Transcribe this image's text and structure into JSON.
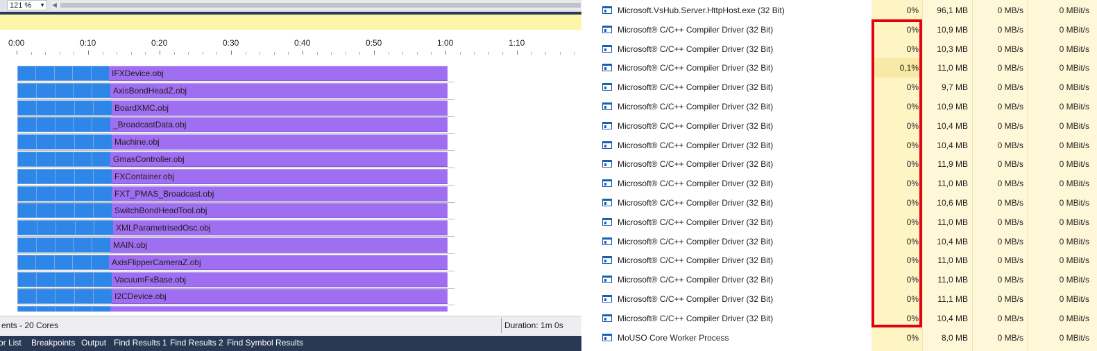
{
  "vs": {
    "zoom_value": "121 %",
    "timeline": {
      "ticks": [
        "0:00",
        "0:10",
        "0:20",
        "0:30",
        "0:40",
        "0:50",
        "1:00",
        "1:10"
      ],
      "items": [
        "IFXDevice.obj",
        "AxisBondHeadZ.obj",
        "BoardXMC.obj",
        "_BroadcastData.obj",
        "Machine.obj",
        "GmasController.obj",
        "FXContainer.obj",
        "FXT_PMAS_Broadcast.obj",
        "SwitchBondHeadTool.obj",
        "XMLParametrisedOsc.obj",
        "MAIN.obj",
        "AxisFlipperCameraZ.obj",
        "VacuumFxBase.obj",
        "I2CDevice.obj"
      ]
    },
    "status_left": "ents - 20 Cores",
    "status_duration": "Duration: 1m 0s",
    "tabs": [
      "or List",
      "Breakpoints",
      "Output",
      "Find Results 1",
      "Find Results 2",
      "Find Symbol Results"
    ]
  },
  "taskmgr": {
    "processes": [
      {
        "name": "Microsoft.VsHub.Server.HttpHost.exe (32 Bit)",
        "cpu": "0%",
        "mem": "96,1 MB",
        "disk": "0 MB/s",
        "net": "0 MBit/s"
      },
      {
        "name": "Microsoft® C/C++ Compiler Driver (32 Bit)",
        "cpu": "0%",
        "mem": "10,9 MB",
        "disk": "0 MB/s",
        "net": "0 MBit/s"
      },
      {
        "name": "Microsoft® C/C++ Compiler Driver (32 Bit)",
        "cpu": "0%",
        "mem": "10,3 MB",
        "disk": "0 MB/s",
        "net": "0 MBit/s"
      },
      {
        "name": "Microsoft® C/C++ Compiler Driver (32 Bit)",
        "cpu": "0,1%",
        "mem": "11,0 MB",
        "disk": "0 MB/s",
        "net": "0 MBit/s"
      },
      {
        "name": "Microsoft® C/C++ Compiler Driver (32 Bit)",
        "cpu": "0%",
        "mem": "9,7 MB",
        "disk": "0 MB/s",
        "net": "0 MBit/s"
      },
      {
        "name": "Microsoft® C/C++ Compiler Driver (32 Bit)",
        "cpu": "0%",
        "mem": "10,9 MB",
        "disk": "0 MB/s",
        "net": "0 MBit/s"
      },
      {
        "name": "Microsoft® C/C++ Compiler Driver (32 Bit)",
        "cpu": "0%",
        "mem": "10,4 MB",
        "disk": "0 MB/s",
        "net": "0 MBit/s"
      },
      {
        "name": "Microsoft® C/C++ Compiler Driver (32 Bit)",
        "cpu": "0%",
        "mem": "10,4 MB",
        "disk": "0 MB/s",
        "net": "0 MBit/s"
      },
      {
        "name": "Microsoft® C/C++ Compiler Driver (32 Bit)",
        "cpu": "0%",
        "mem": "11,9 MB",
        "disk": "0 MB/s",
        "net": "0 MBit/s"
      },
      {
        "name": "Microsoft® C/C++ Compiler Driver (32 Bit)",
        "cpu": "0%",
        "mem": "11,0 MB",
        "disk": "0 MB/s",
        "net": "0 MBit/s"
      },
      {
        "name": "Microsoft® C/C++ Compiler Driver (32 Bit)",
        "cpu": "0%",
        "mem": "10,6 MB",
        "disk": "0 MB/s",
        "net": "0 MBit/s"
      },
      {
        "name": "Microsoft® C/C++ Compiler Driver (32 Bit)",
        "cpu": "0%",
        "mem": "11,0 MB",
        "disk": "0 MB/s",
        "net": "0 MBit/s"
      },
      {
        "name": "Microsoft® C/C++ Compiler Driver (32 Bit)",
        "cpu": "0%",
        "mem": "10,4 MB",
        "disk": "0 MB/s",
        "net": "0 MBit/s"
      },
      {
        "name": "Microsoft® C/C++ Compiler Driver (32 Bit)",
        "cpu": "0%",
        "mem": "11,0 MB",
        "disk": "0 MB/s",
        "net": "0 MBit/s"
      },
      {
        "name": "Microsoft® C/C++ Compiler Driver (32 Bit)",
        "cpu": "0%",
        "mem": "11,0 MB",
        "disk": "0 MB/s",
        "net": "0 MBit/s"
      },
      {
        "name": "Microsoft® C/C++ Compiler Driver (32 Bit)",
        "cpu": "0%",
        "mem": "11,1 MB",
        "disk": "0 MB/s",
        "net": "0 MBit/s"
      },
      {
        "name": "Microsoft® C/C++ Compiler Driver (32 Bit)",
        "cpu": "0%",
        "mem": "10,4 MB",
        "disk": "0 MB/s",
        "net": "0 MBit/s"
      },
      {
        "name": "MoUSO Core Worker Process",
        "cpu": "0%",
        "mem": "8,0 MB",
        "disk": "0 MB/s",
        "net": "0 MBit/s"
      }
    ],
    "highlighted_cpu_row": 3,
    "colors": {
      "cpu_column": "#fff4c4",
      "other_columns": "#fff8d8",
      "highlight_cell": "#f9e9a6",
      "annotation_box": "#e3000f"
    }
  }
}
